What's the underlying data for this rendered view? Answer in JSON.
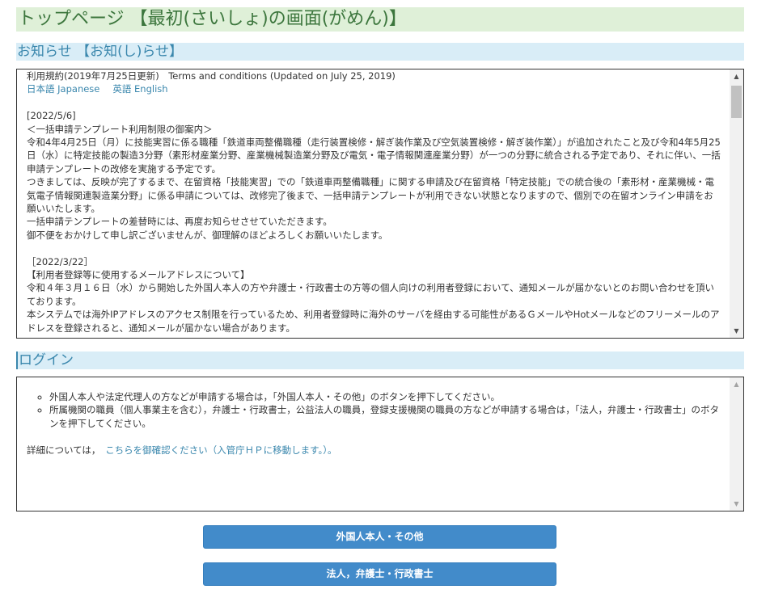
{
  "page_title": "トップページ 【最初(さいしょ)の画面(がめん)】",
  "news": {
    "heading": "お知らせ 【お知(し)らせ】",
    "terms_line": "利用規約(2019年7月25日更新)　Terms and conditions (Updated on July 25, 2019)",
    "lang_japanese": "日本語 Japanese",
    "lang_english": "英語 English",
    "item1": {
      "date": "[2022/5/6]",
      "title": "＜一括申請テンプレート利用制限の御案内＞",
      "para1": "令和4年4月25日（月）に技能実習に係る職種「鉄道車両整備職種（走行装置検修・解ぎ装作業及び空気装置検修・解ぎ装作業）」が追加されたこと及び令和4年5月25日（水）に特定技能の製造3分野（素形材産業分野、産業機械製造業分野及び電気・電子情報関連産業分野）が一つの分野に統合される予定であり、それに伴い、一括申請テンプレートの改修を実施する予定です。",
      "para2": "つきましては、反映が完了するまで、在留資格「技能実習」での「鉄道車両整備職種」に関する申請及び在留資格「特定技能」での統合後の「素形材・産業機械・電気電子情報関連製造業分野」に係る申請については、改修完了後まで、一括申請テンプレートが利用できない状態となりますので、個別での在留オンライン申請をお願いいたします。",
      "para3": "一括申請テンプレートの差替時には、再度お知らせさせていただきます。",
      "para4": "御不便をおかけして申し訳ございませんが、御理解のほどよろしくお願いいたします。"
    },
    "item2": {
      "date": "［2022/3/22］",
      "title": "【利用者登録等に使用するメールアドレスについて】",
      "para1": "令和４年３月１６日（水）から開始した外国人本人の方や弁護士・行政書士の方等の個人向けの利用者登録において、通知メールが届かないとのお問い合わせを頂いております。",
      "para2": "本システムでは海外IPアドレスのアクセス制限を行っているため、利用者登録時に海外のサーバを経由する可能性があるＧメールやHotメールなどのフリーメールのアドレスを登録されると、通知メールが届かない場合があります。"
    }
  },
  "login": {
    "heading": "ログイン",
    "bullet1": "外国人本人や法定代理人の方などが申請する場合は，「外国人本人・その他」のボタンを押下してください。",
    "bullet2": "所属機関の職員（個人事業主を含む），弁護士・行政書士，公益法人の職員，登録支援機関の職員の方などが申請する場合は，「法人，弁護士・行政書士」のボタンを押下してください。",
    "details_prefix": "詳細については，",
    "details_link": "こちらを御確認ください（入管庁ＨＰに移動します。）。"
  },
  "buttons": {
    "foreign": "外国人本人・その他",
    "legal": "法人，弁護士・行政書士"
  },
  "colors": {
    "title_bg": "#dff0d8",
    "title_text": "#3c763d",
    "section_bg": "#d9edf7",
    "section_text": "#3a87ad",
    "link": "#3a87ad",
    "button_bg": "#428bca"
  },
  "icons": {
    "scroll_up": "triangle-up-icon",
    "scroll_down": "triangle-down-icon"
  }
}
